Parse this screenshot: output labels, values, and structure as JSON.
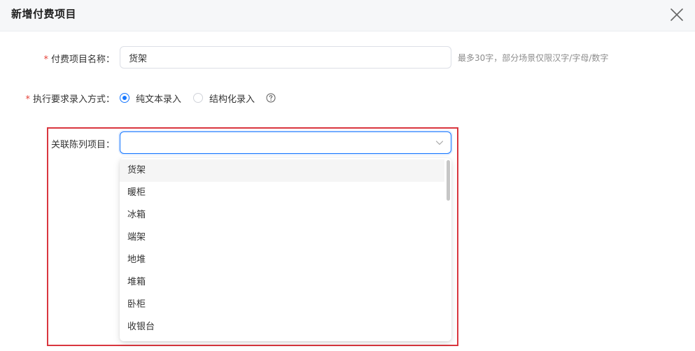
{
  "dialog": {
    "title": "新增付费项目"
  },
  "form": {
    "item_name": {
      "required_mark": "*",
      "label": "付费项目名称：",
      "value": "货架",
      "hint": "最多30字，部分场景仅限汉字/字母/数字"
    },
    "input_mode": {
      "required_mark": "*",
      "label": "执行要求录入方式：",
      "options": [
        {
          "label": "纯文本录入",
          "checked": true
        },
        {
          "label": "结构化录入",
          "checked": false
        }
      ]
    },
    "linked_display": {
      "label": "关联陈列项目：",
      "value": "",
      "options": [
        "货架",
        "暖柜",
        "冰箱",
        "端架",
        "地堆",
        "堆箱",
        "卧柜",
        "收银台"
      ],
      "hovered_index": 0
    }
  },
  "colors": {
    "accent": "#1677ff",
    "required": "#e6433a",
    "highlight_border": "#d9363e",
    "header_bg": "#f6f7f9"
  },
  "icons": {
    "close": "close-icon",
    "help": "question-circle-icon",
    "select_arrow": "chevron-down-icon"
  }
}
